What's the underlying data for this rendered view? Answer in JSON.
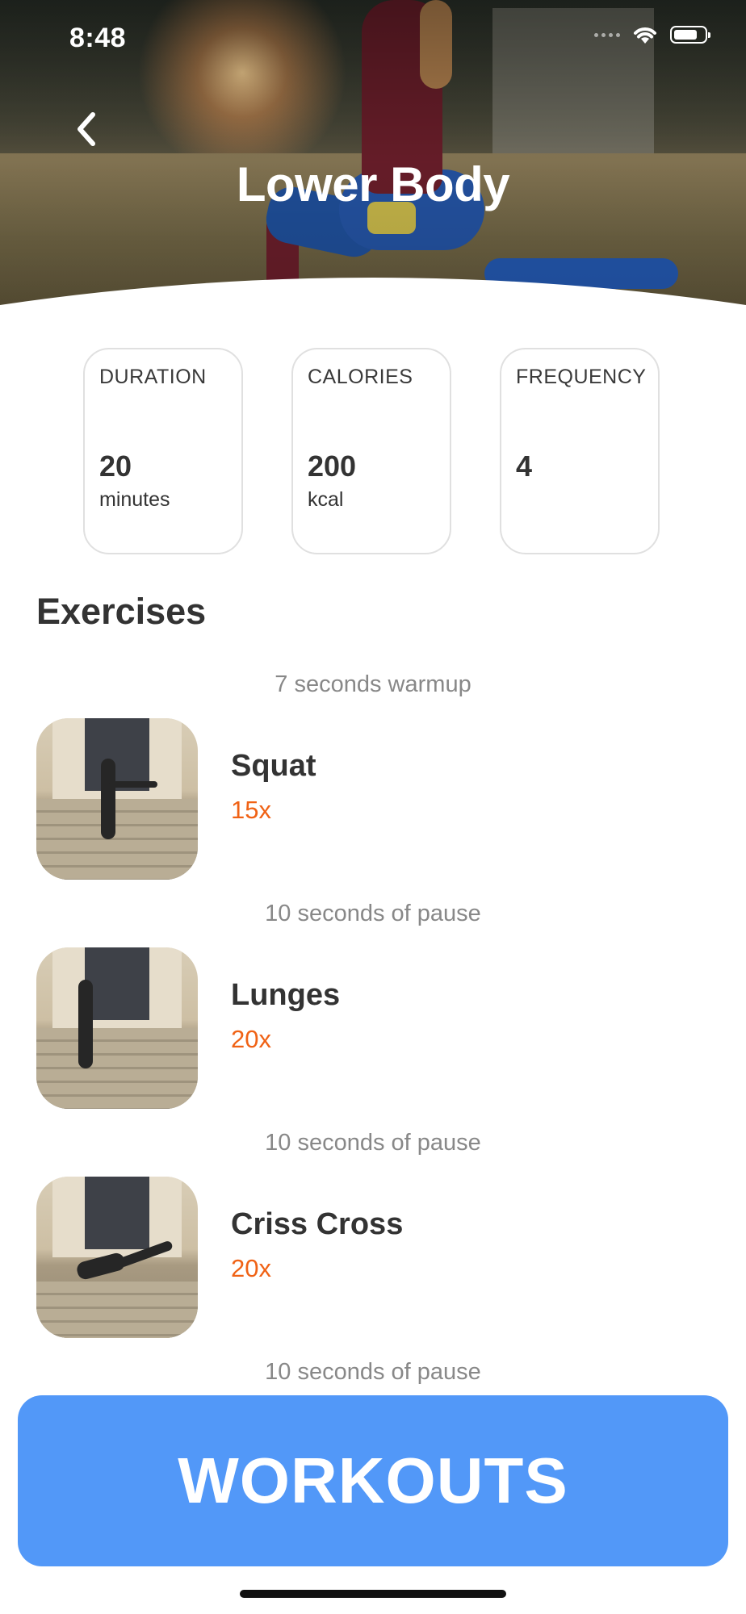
{
  "status_bar": {
    "time": "8:48"
  },
  "header": {
    "title": "Lower Body"
  },
  "stats": [
    {
      "label": "DURATION",
      "value": "20",
      "unit": "minutes"
    },
    {
      "label": "CALORIES",
      "value": "200",
      "unit": "kcal"
    },
    {
      "label": "FREQUENCY",
      "value": "4",
      "unit": ""
    }
  ],
  "exercises_section": {
    "title": "Exercises",
    "warmup": "7 seconds warmup",
    "items": [
      {
        "name": "Squat",
        "reps": "15x",
        "pause": "10 seconds of pause"
      },
      {
        "name": "Lunges",
        "reps": "20x",
        "pause": "10 seconds of pause"
      },
      {
        "name": "Criss Cross",
        "reps": "20x",
        "pause": "10 seconds of pause"
      }
    ]
  },
  "footer": {
    "button_label": "WORKOUTS"
  },
  "colors": {
    "accent": "#5298f8",
    "reps": "#f06215",
    "text": "#333333",
    "muted": "#888888"
  }
}
